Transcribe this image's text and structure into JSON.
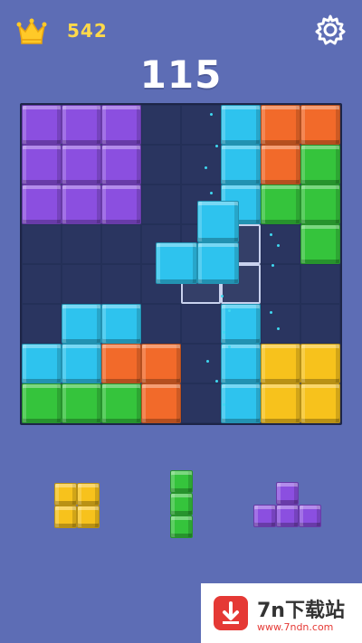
{
  "header": {
    "best_score": "542",
    "crown_icon": "crown-icon",
    "settings_icon": "gear-icon"
  },
  "score": "115",
  "colors": {
    "background": "#5d6db5",
    "board": "#2a3560",
    "purple": "#8b4fe0",
    "cyan": "#2ec3ee",
    "orange": "#f26a2a",
    "green": "#35c43c",
    "yellow": "#f7c21c",
    "ghost": "#c9d2ee"
  },
  "board": {
    "size": 8,
    "rows": [
      [
        "P",
        "P",
        "P",
        ".",
        ".",
        "C",
        "O",
        "O"
      ],
      [
        "P",
        "P",
        "P",
        ".",
        ".",
        "C",
        "O",
        "G"
      ],
      [
        "P",
        "P",
        "P",
        ".",
        ".",
        "C",
        "G",
        "G"
      ],
      [
        ".",
        ".",
        ".",
        ".",
        ".",
        ".",
        ".",
        "G"
      ],
      [
        ".",
        ".",
        ".",
        ".",
        ".",
        ".",
        ".",
        "."
      ],
      [
        ".",
        "C",
        "C",
        ".",
        ".",
        "C",
        ".",
        "."
      ],
      [
        "C",
        "C",
        "O",
        "O",
        ".",
        "C",
        "Y",
        "Y"
      ],
      [
        "G",
        "G",
        "G",
        "O",
        ".",
        "C",
        "Y",
        "Y"
      ]
    ]
  },
  "dragging_piece": {
    "color": "C",
    "cells": [
      [
        0,
        1
      ],
      [
        1,
        0
      ],
      [
        1,
        1
      ]
    ]
  },
  "ghost_cells": [
    [
      3,
      5
    ],
    [
      4,
      4
    ],
    [
      4,
      5
    ]
  ],
  "tray": [
    {
      "name": "square-piece",
      "color": "Y",
      "cells": [
        [
          0,
          0
        ],
        [
          0,
          1
        ],
        [
          1,
          0
        ],
        [
          1,
          1
        ]
      ]
    },
    {
      "name": "vertical-i3-piece",
      "color": "G",
      "cells": [
        [
          0,
          0
        ],
        [
          1,
          0
        ],
        [
          2,
          0
        ]
      ]
    },
    {
      "name": "t-piece",
      "color": "P",
      "cells": [
        [
          0,
          1
        ],
        [
          1,
          0
        ],
        [
          1,
          1
        ],
        [
          1,
          2
        ]
      ]
    }
  ],
  "watermark": {
    "title": "7n下载站",
    "url": "www.7ndn.com"
  }
}
